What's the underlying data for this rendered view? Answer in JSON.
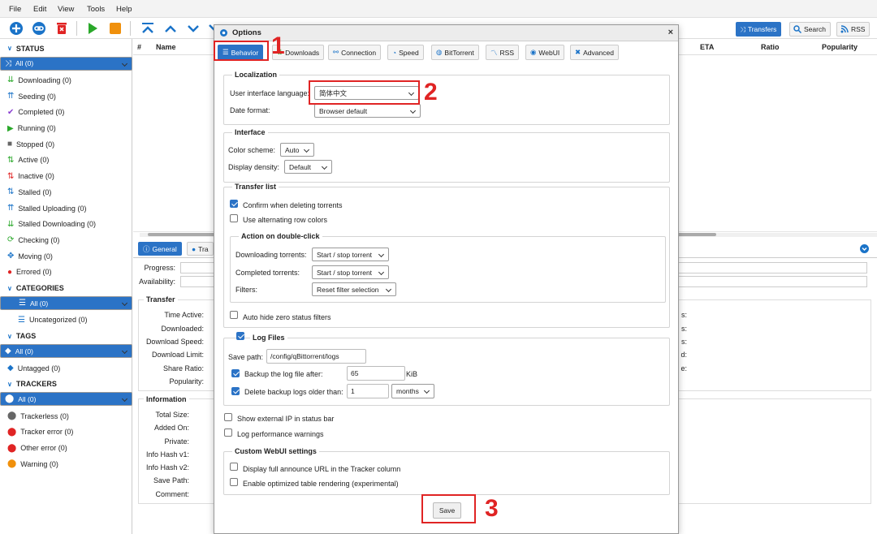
{
  "menu": {
    "file": "File",
    "edit": "Edit",
    "view": "View",
    "tools": "Tools",
    "help": "Help"
  },
  "toolbar": {
    "transfers": "Transfers",
    "search": "Search",
    "rss": "RSS"
  },
  "columns": {
    "num": "#",
    "name": "Name",
    "eta": "ETA",
    "ratio": "Ratio",
    "popularity": "Popularity"
  },
  "sidebar": {
    "status_header": "STATUS",
    "status": [
      {
        "label": "All (0)",
        "icon": "shuffle-icon"
      },
      {
        "label": "Downloading (0)",
        "icon": "download-icon"
      },
      {
        "label": "Seeding (0)",
        "icon": "upload-icon"
      },
      {
        "label": "Completed (0)",
        "icon": "check-icon"
      },
      {
        "label": "Running (0)",
        "icon": "play-icon"
      },
      {
        "label": "Stopped (0)",
        "icon": "stop-icon"
      },
      {
        "label": "Active (0)",
        "icon": "active-icon"
      },
      {
        "label": "Inactive (0)",
        "icon": "inactive-icon"
      },
      {
        "label": "Stalled (0)",
        "icon": "stalled-icon"
      },
      {
        "label": "Stalled Uploading (0)",
        "icon": "stalled-upload-icon"
      },
      {
        "label": "Stalled Downloading (0)",
        "icon": "stalled-download-icon"
      },
      {
        "label": "Checking (0)",
        "icon": "refresh-icon"
      },
      {
        "label": "Moving (0)",
        "icon": "move-icon"
      },
      {
        "label": "Errored (0)",
        "icon": "error-icon"
      }
    ],
    "categories_header": "CATEGORIES",
    "categories": [
      {
        "label": "All (0)"
      },
      {
        "label": "Uncategorized (0)"
      }
    ],
    "tags_header": "TAGS",
    "tags": [
      {
        "label": "All (0)"
      },
      {
        "label": "Untagged (0)"
      }
    ],
    "trackers_header": "TRACKERS",
    "trackers": [
      {
        "label": "All (0)"
      },
      {
        "label": "Trackerless (0)"
      },
      {
        "label": "Tracker error (0)"
      },
      {
        "label": "Other error (0)"
      },
      {
        "label": "Warning (0)"
      }
    ]
  },
  "props": {
    "tab_general": "General",
    "tab_trackers": "Tra",
    "progress": "Progress:",
    "availability": "Availability:",
    "transfer_title": "Transfer",
    "time_active": "Time Active:",
    "downloaded": "Downloaded:",
    "download_speed": "Download Speed:",
    "download_limit": "Download Limit:",
    "share_ratio": "Share Ratio:",
    "popularity": "Popularity:",
    "information_title": "Information",
    "total_size": "Total Size:",
    "added_on": "Added On:",
    "private": "Private:",
    "info_hash_v1": "Info Hash v1:",
    "info_hash_v2": "Info Hash v2:",
    "save_path": "Save Path:",
    "comment": "Comment:",
    "right_frags": [
      "s:",
      "s:",
      "s:",
      "d:",
      "e:"
    ]
  },
  "modal": {
    "title": "Options",
    "close": "×",
    "tabs": [
      "Behavior",
      "Downloads",
      "Connection",
      "Speed",
      "BitTorrent",
      "RSS",
      "WebUI",
      "Advanced"
    ],
    "localization": {
      "title": "Localization",
      "language_label": "User interface language:",
      "language_value": "简体中文",
      "date_label": "Date format:",
      "date_value": "Browser default"
    },
    "interface": {
      "title": "Interface",
      "scheme_label": "Color scheme:",
      "scheme_value": "Auto",
      "density_label": "Display density:",
      "density_value": "Default"
    },
    "transfer_list": {
      "title": "Transfer list",
      "confirm_delete": "Confirm when deleting torrents",
      "alt_rows": "Use alternating row colors",
      "double_click_title": "Action on double-click",
      "downloading_label": "Downloading torrents:",
      "downloading_value": "Start / stop torrent",
      "completed_label": "Completed torrents:",
      "completed_value": "Start / stop torrent",
      "filters_label": "Filters:",
      "filters_value": "Reset filter selection",
      "auto_hide": "Auto hide zero status filters"
    },
    "log": {
      "title": "Log Files",
      "save_path_label": "Save path:",
      "save_path_value": "/config/qBittorrent/logs",
      "backup_label": "Backup the log file after:",
      "backup_value": "65",
      "backup_unit": "KiB",
      "delete_label": "Delete backup logs older than:",
      "delete_value": "1",
      "delete_unit": "months"
    },
    "show_ip": "Show external IP in status bar",
    "log_perf": "Log performance warnings",
    "custom": {
      "title": "Custom WebUI settings",
      "full_url": "Display full announce URL in the Tracker column",
      "optimized": "Enable optimized table rendering (experimental)"
    },
    "save": "Save"
  },
  "annotations": {
    "one": "1",
    "two": "2",
    "three": "3"
  },
  "colors": {
    "accent": "#2b73c6",
    "annotation": "#e02424"
  }
}
